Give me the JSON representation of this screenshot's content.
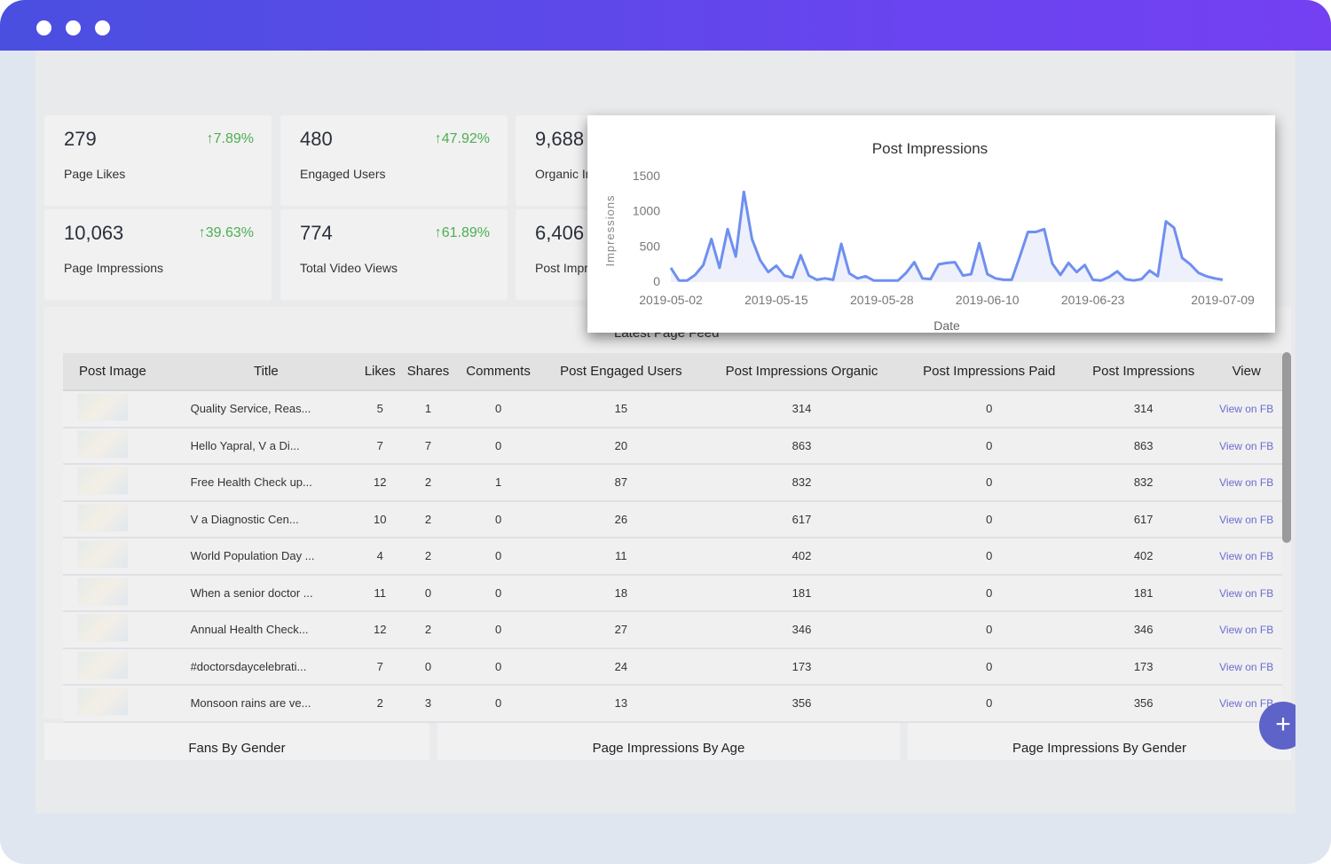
{
  "window": {
    "dots": 3
  },
  "kpis": [
    {
      "value": "279",
      "change": "↑7.89%",
      "label": "Page Likes"
    },
    {
      "value": "480",
      "change": "↑47.92%",
      "label": "Engaged Users"
    },
    {
      "value": "9,688",
      "change": "",
      "label": "Organic Impressions"
    },
    {
      "value": "10,063",
      "change": "↑39.63%",
      "label": "Page Impressions"
    },
    {
      "value": "774",
      "change": "↑61.89%",
      "label": "Total Video Views"
    },
    {
      "value": "6,406",
      "change": "",
      "label": "Post Impressions"
    }
  ],
  "feed": {
    "title": "Latest Page Feed",
    "columns": [
      "Post Image",
      "Title",
      "Likes",
      "Shares",
      "Comments",
      "Post Engaged Users",
      "Post Impressions Organic",
      "Post Impressions Paid",
      "Post Impressions",
      "View"
    ],
    "rows": [
      {
        "title": "Quality Service, Reas...",
        "likes": "5",
        "shares": "1",
        "comments": "0",
        "engaged": "15",
        "organic": "314",
        "paid": "0",
        "impressions": "314",
        "view": "View on FB"
      },
      {
        "title": "Hello Yapral, V      a Di...",
        "likes": "7",
        "shares": "7",
        "comments": "0",
        "engaged": "20",
        "organic": "863",
        "paid": "0",
        "impressions": "863",
        "view": "View on FB"
      },
      {
        "title": "Free Health Check up...",
        "likes": "12",
        "shares": "2",
        "comments": "1",
        "engaged": "87",
        "organic": "832",
        "paid": "0",
        "impressions": "832",
        "view": "View on FB"
      },
      {
        "title": "V      a Diagnostic Cen...",
        "likes": "10",
        "shares": "2",
        "comments": "0",
        "engaged": "26",
        "organic": "617",
        "paid": "0",
        "impressions": "617",
        "view": "View on FB"
      },
      {
        "title": "World Population Day ...",
        "likes": "4",
        "shares": "2",
        "comments": "0",
        "engaged": "11",
        "organic": "402",
        "paid": "0",
        "impressions": "402",
        "view": "View on FB"
      },
      {
        "title": "When a senior doctor ...",
        "likes": "11",
        "shares": "0",
        "comments": "0",
        "engaged": "18",
        "organic": "181",
        "paid": "0",
        "impressions": "181",
        "view": "View on FB"
      },
      {
        "title": "Annual Health Check...",
        "likes": "12",
        "shares": "2",
        "comments": "0",
        "engaged": "27",
        "organic": "346",
        "paid": "0",
        "impressions": "346",
        "view": "View on FB"
      },
      {
        "title": "#doctorsdaycelebrati...",
        "likes": "7",
        "shares": "0",
        "comments": "0",
        "engaged": "24",
        "organic": "173",
        "paid": "0",
        "impressions": "173",
        "view": "View on FB"
      },
      {
        "title": "Monsoon rains are ve...",
        "likes": "2",
        "shares": "3",
        "comments": "0",
        "engaged": "13",
        "organic": "356",
        "paid": "0",
        "impressions": "356",
        "view": "View on FB"
      }
    ]
  },
  "bottom_cards": [
    "Fans By Gender",
    "Page Impressions By Age",
    "Page Impressions By Gender"
  ],
  "fab": {
    "icon": "plus-icon",
    "label": "+"
  },
  "colors": {
    "accent": "#5e63c9",
    "positive": "#4caf50",
    "line": "#6f8ff0",
    "link": "#6b6ccf"
  },
  "chart_data": {
    "type": "area",
    "title": "Post Impressions",
    "xlabel": "Date",
    "ylabel": "Impressions",
    "ylim": [
      0,
      1500
    ],
    "yticks": [
      "0",
      "500",
      "1000",
      "1500"
    ],
    "xticks": [
      "2019-05-02",
      "2019-05-15",
      "2019-05-28",
      "2019-06-10",
      "2019-06-23",
      "2019-07-09"
    ],
    "x": [
      "2019-05-02",
      "2019-05-03",
      "2019-05-04",
      "2019-05-05",
      "2019-05-06",
      "2019-05-07",
      "2019-05-08",
      "2019-05-09",
      "2019-05-10",
      "2019-05-11",
      "2019-05-12",
      "2019-05-13",
      "2019-05-14",
      "2019-05-15",
      "2019-05-16",
      "2019-05-17",
      "2019-05-18",
      "2019-05-19",
      "2019-05-20",
      "2019-05-21",
      "2019-05-22",
      "2019-05-23",
      "2019-05-24",
      "2019-05-25",
      "2019-05-26",
      "2019-05-27",
      "2019-05-28",
      "2019-05-29",
      "2019-05-30",
      "2019-05-31",
      "2019-06-01",
      "2019-06-02",
      "2019-06-03",
      "2019-06-04",
      "2019-06-05",
      "2019-06-06",
      "2019-06-07",
      "2019-06-08",
      "2019-06-09",
      "2019-06-10",
      "2019-06-11",
      "2019-06-12",
      "2019-06-13",
      "2019-06-14",
      "2019-06-15",
      "2019-06-16",
      "2019-06-17",
      "2019-06-18",
      "2019-06-19",
      "2019-06-20",
      "2019-06-21",
      "2019-06-22",
      "2019-06-23",
      "2019-06-24",
      "2019-06-25",
      "2019-06-26",
      "2019-06-27",
      "2019-06-28",
      "2019-06-29",
      "2019-06-30",
      "2019-07-01",
      "2019-07-02",
      "2019-07-03",
      "2019-07-04",
      "2019-07-05",
      "2019-07-06",
      "2019-07-07",
      "2019-07-08",
      "2019-07-09"
    ],
    "values": [
      190,
      10,
      10,
      90,
      230,
      600,
      190,
      740,
      350,
      1270,
      600,
      300,
      130,
      220,
      80,
      50,
      370,
      80,
      20,
      40,
      20,
      530,
      110,
      40,
      70,
      10,
      10,
      10,
      10,
      120,
      270,
      40,
      30,
      240,
      260,
      270,
      80,
      100,
      540,
      100,
      40,
      20,
      20,
      350,
      700,
      700,
      740,
      250,
      90,
      260,
      130,
      230,
      20,
      10,
      60,
      140,
      30,
      10,
      30,
      150,
      70,
      850,
      760,
      330,
      240,
      120,
      70,
      40,
      20
    ],
    "grid": false,
    "legend": "none"
  }
}
